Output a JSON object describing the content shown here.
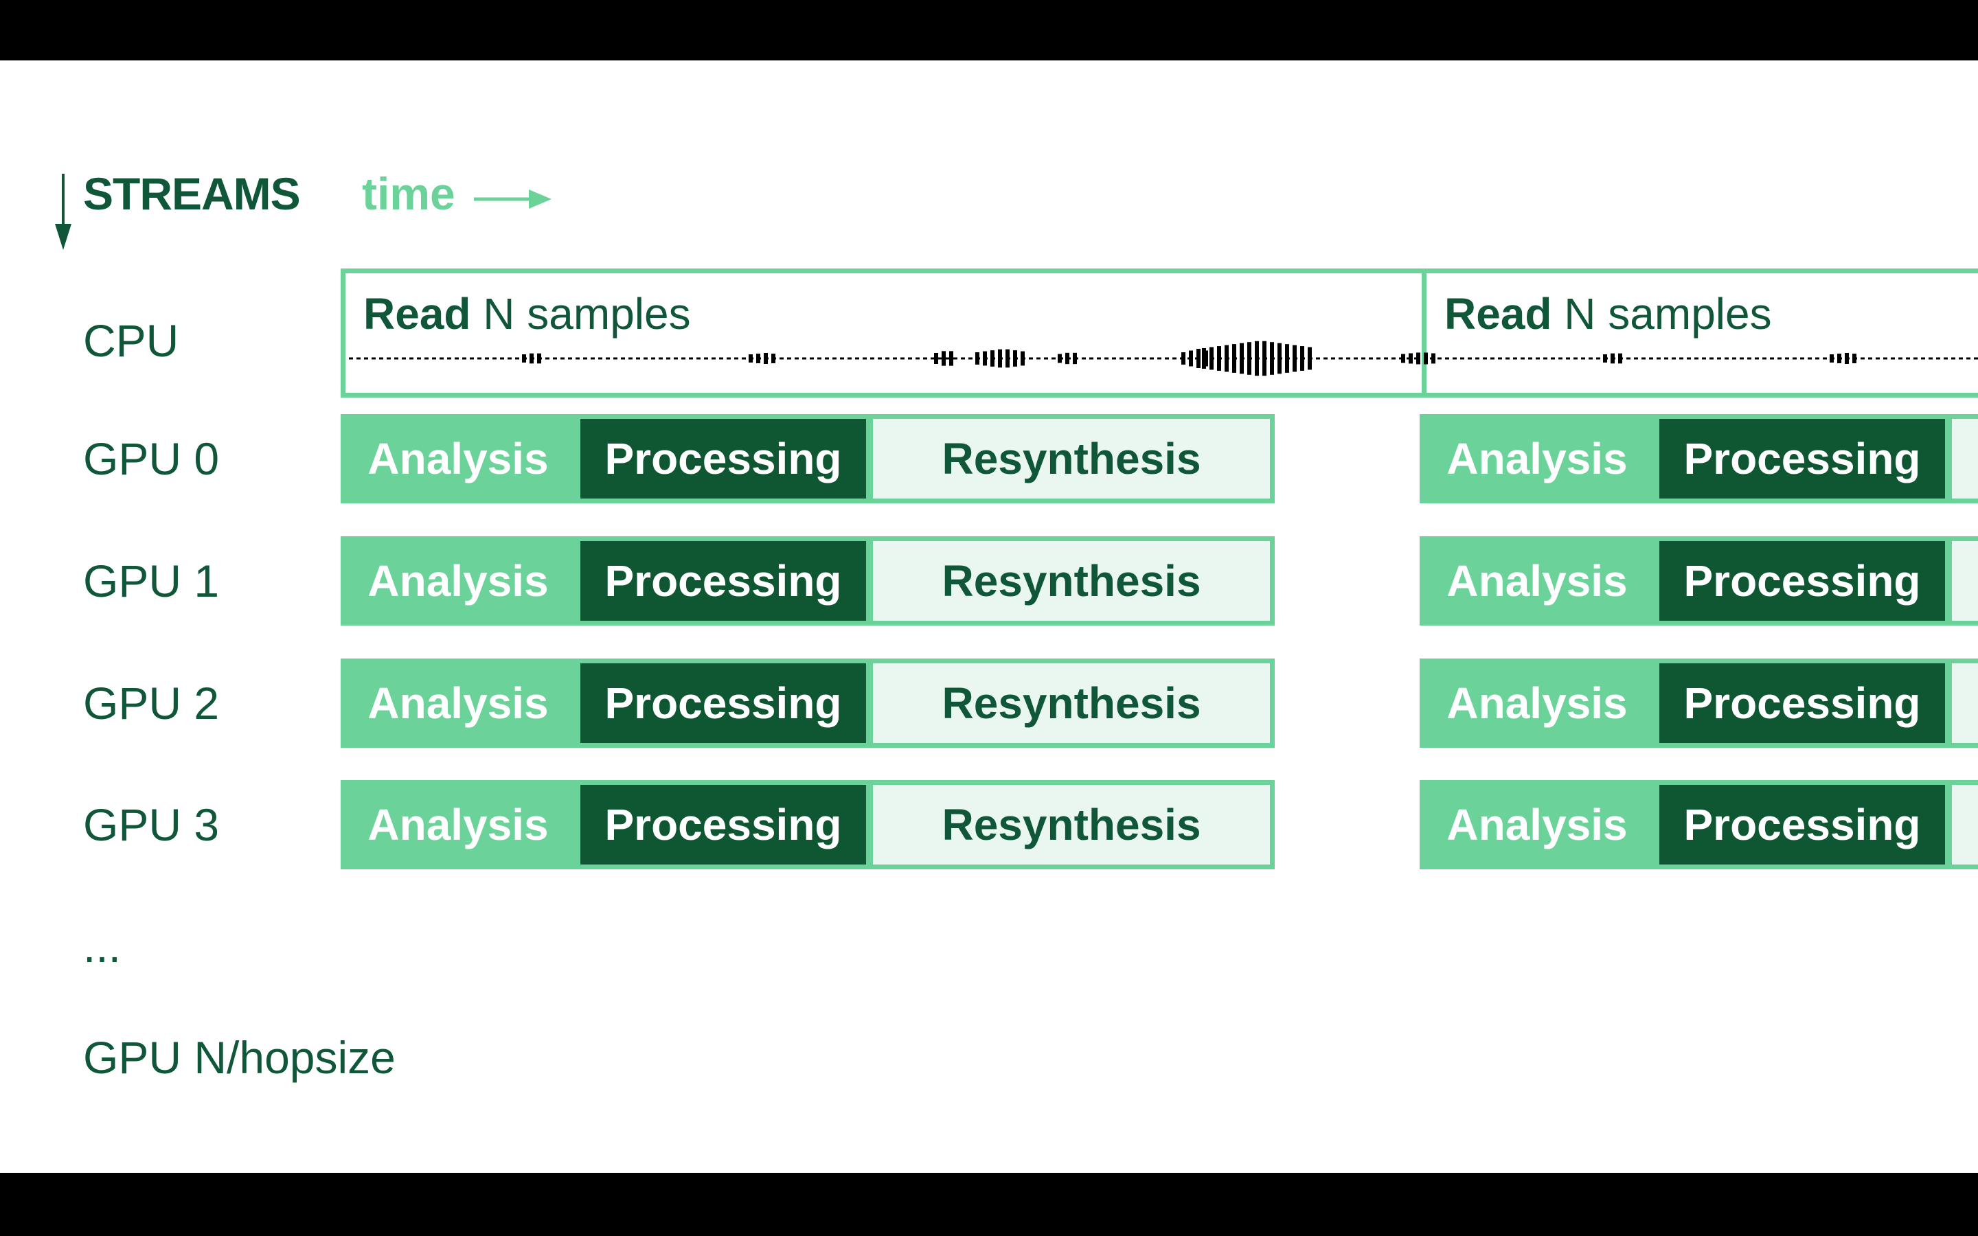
{
  "header": {
    "streams_label": "STREAMS",
    "time_label": "time",
    "streams_arrow_icon": "arrow-down",
    "time_arrow_icon": "arrow-right"
  },
  "colors": {
    "dark_green": "#0f5733",
    "light_green": "#6bd39a",
    "pale_green": "#eaf7f0"
  },
  "cpu": {
    "label": "CPU",
    "blocks": [
      {
        "bold": "Read",
        "rest": "N samples"
      },
      {
        "bold": "Read",
        "rest": "N samples"
      }
    ]
  },
  "gpus": [
    {
      "label": "GPU 0",
      "stages": [
        "Analysis",
        "Processing",
        "Resynthesis"
      ]
    },
    {
      "label": "GPU 1",
      "stages": [
        "Analysis",
        "Processing",
        "Resynthesis"
      ]
    },
    {
      "label": "GPU 2",
      "stages": [
        "Analysis",
        "Processing",
        "Resynthesis"
      ]
    },
    {
      "label": "GPU 3",
      "stages": [
        "Analysis",
        "Processing",
        "Resynthesis"
      ]
    }
  ],
  "ellipsis": "...",
  "last_gpu_label": "GPU N/hopsize"
}
